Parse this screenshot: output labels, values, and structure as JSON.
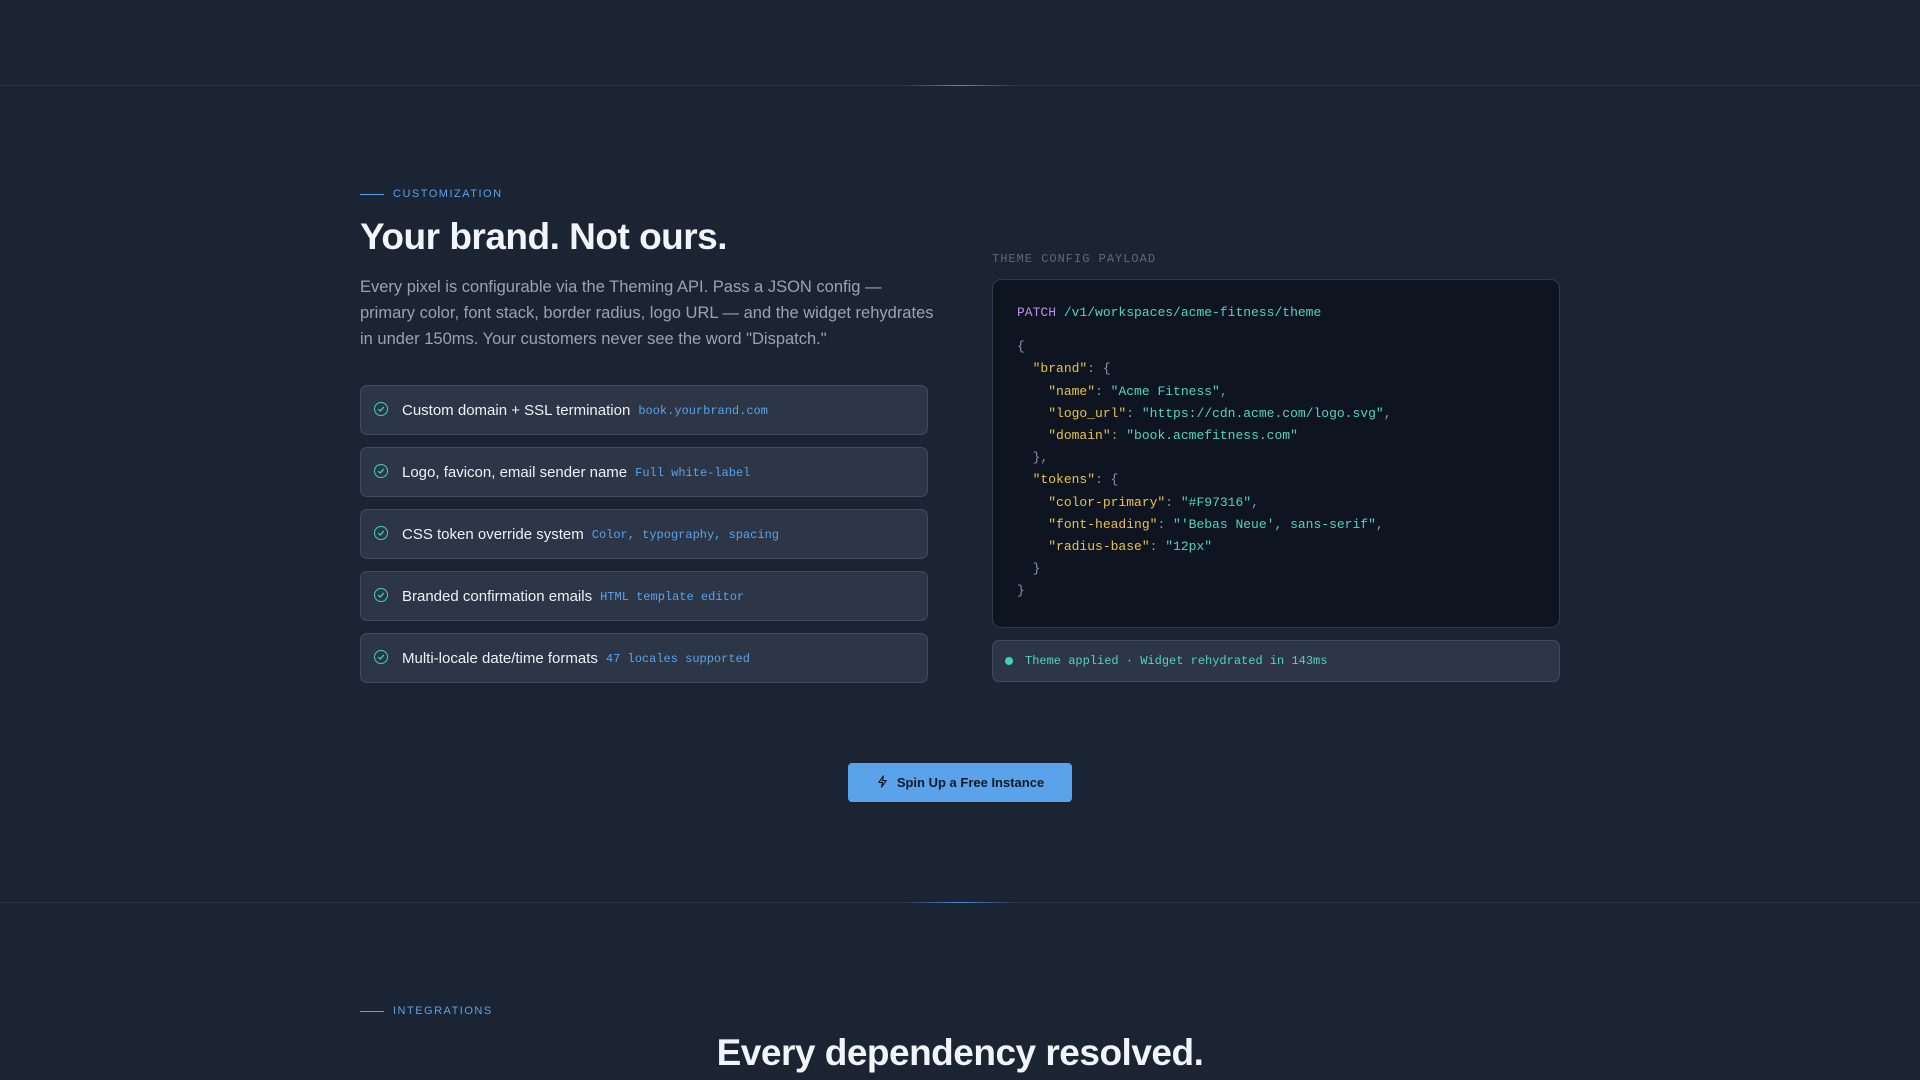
{
  "customization": {
    "eyebrow": "CUSTOMIZATION",
    "heading": "Your brand. Not ours.",
    "lead": "Every pixel is configurable via the Theming API. Pass a JSON config — primary color, font stack, border radius, logo URL — and the widget rehydrates in under 150ms. Your customers never see the word \"Dispatch.\"",
    "features": [
      {
        "label": "Custom domain + SSL termination",
        "tag": "book.yourbrand.com"
      },
      {
        "label": "Logo, favicon, email sender name",
        "tag": "Full white-label"
      },
      {
        "label": "CSS token override system",
        "tag": "Color, typography, spacing"
      },
      {
        "label": "Branded confirmation emails",
        "tag": "HTML template editor"
      },
      {
        "label": "Multi-locale date/time formats",
        "tag": "47 locales supported"
      }
    ]
  },
  "code": {
    "caption": "THEME CONFIG PAYLOAD",
    "method": "PATCH",
    "path": "/v1/workspaces/acme-fitness/theme",
    "brand_key": "\"brand\"",
    "name_key": "\"name\"",
    "name_val": "\"Acme Fitness\"",
    "logo_key": "\"logo_url\"",
    "logo_val": "\"https://cdn.acme.com/logo.svg\"",
    "domain_key": "\"domain\"",
    "domain_val": "\"book.acmefitness.com\"",
    "tokens_key": "\"tokens\"",
    "color_key": "\"color-primary\"",
    "color_val": "\"#F97316\"",
    "font_key": "\"font-heading\"",
    "font_val": "\"'Bebas Neue', sans-serif\"",
    "radius_key": "\"radius-base\"",
    "radius_val": "\"12px\""
  },
  "status": {
    "text": "Theme applied · Widget rehydrated in 143ms"
  },
  "cta": {
    "label": "Spin Up a Free Instance",
    "icon": "lightning-icon"
  },
  "integrations": {
    "eyebrow": "INTEGRATIONS",
    "heading": "Every dependency resolved."
  },
  "colors": {
    "background": "#1b2433",
    "accent": "#5aa2ea",
    "success": "#3ed3b5",
    "code_key": "#e8c24a",
    "code_method": "#c08ff0"
  }
}
